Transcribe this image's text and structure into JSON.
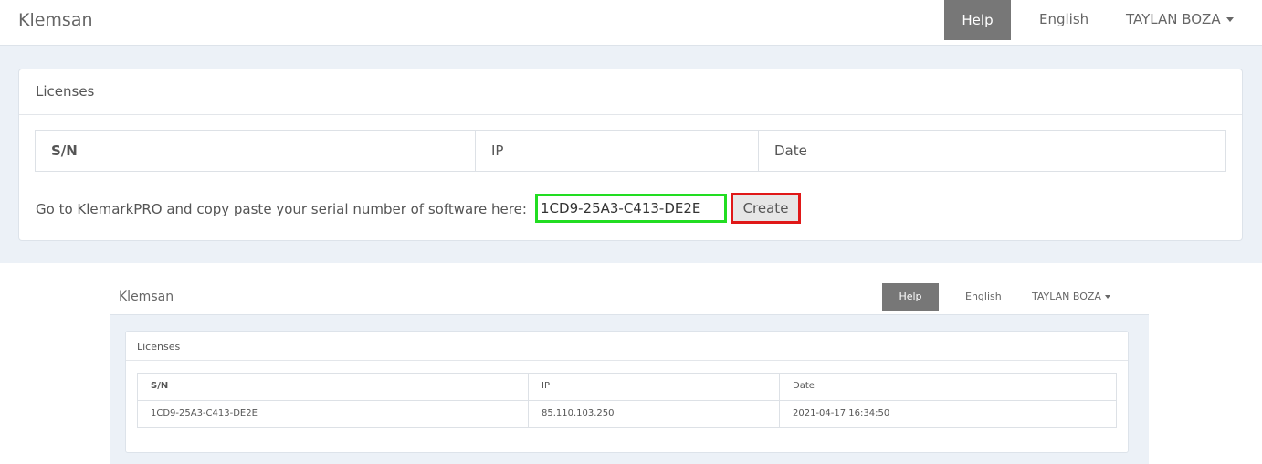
{
  "top": {
    "navbar": {
      "brand": "Klemsan",
      "help_label": "Help",
      "language_label": "English",
      "user_label": "TAYLAN BOZA"
    },
    "panel": {
      "heading": "Licenses",
      "table_headers": [
        "S/N",
        "IP",
        "Date"
      ],
      "instruction": "Go to KlemarkPRO and copy paste your serial number of software here:",
      "serial_input_value": "1CD9-25A3-C413-DE2E",
      "create_label": "Create"
    },
    "colors": {
      "input_highlight": "#22dd22",
      "button_highlight": "#e01818",
      "help_bg": "#777777"
    }
  },
  "bottom": {
    "navbar": {
      "brand": "Klemsan",
      "help_label": "Help",
      "language_label": "English",
      "user_label": "TAYLAN BOZA"
    },
    "panel": {
      "heading": "Licenses",
      "table_headers": [
        "S/N",
        "IP",
        "Date"
      ],
      "rows": [
        {
          "sn": "1CD9-25A3-C413-DE2E",
          "ip": "85.110.103.250",
          "date": "2021-04-17 16:34:50"
        }
      ]
    }
  }
}
